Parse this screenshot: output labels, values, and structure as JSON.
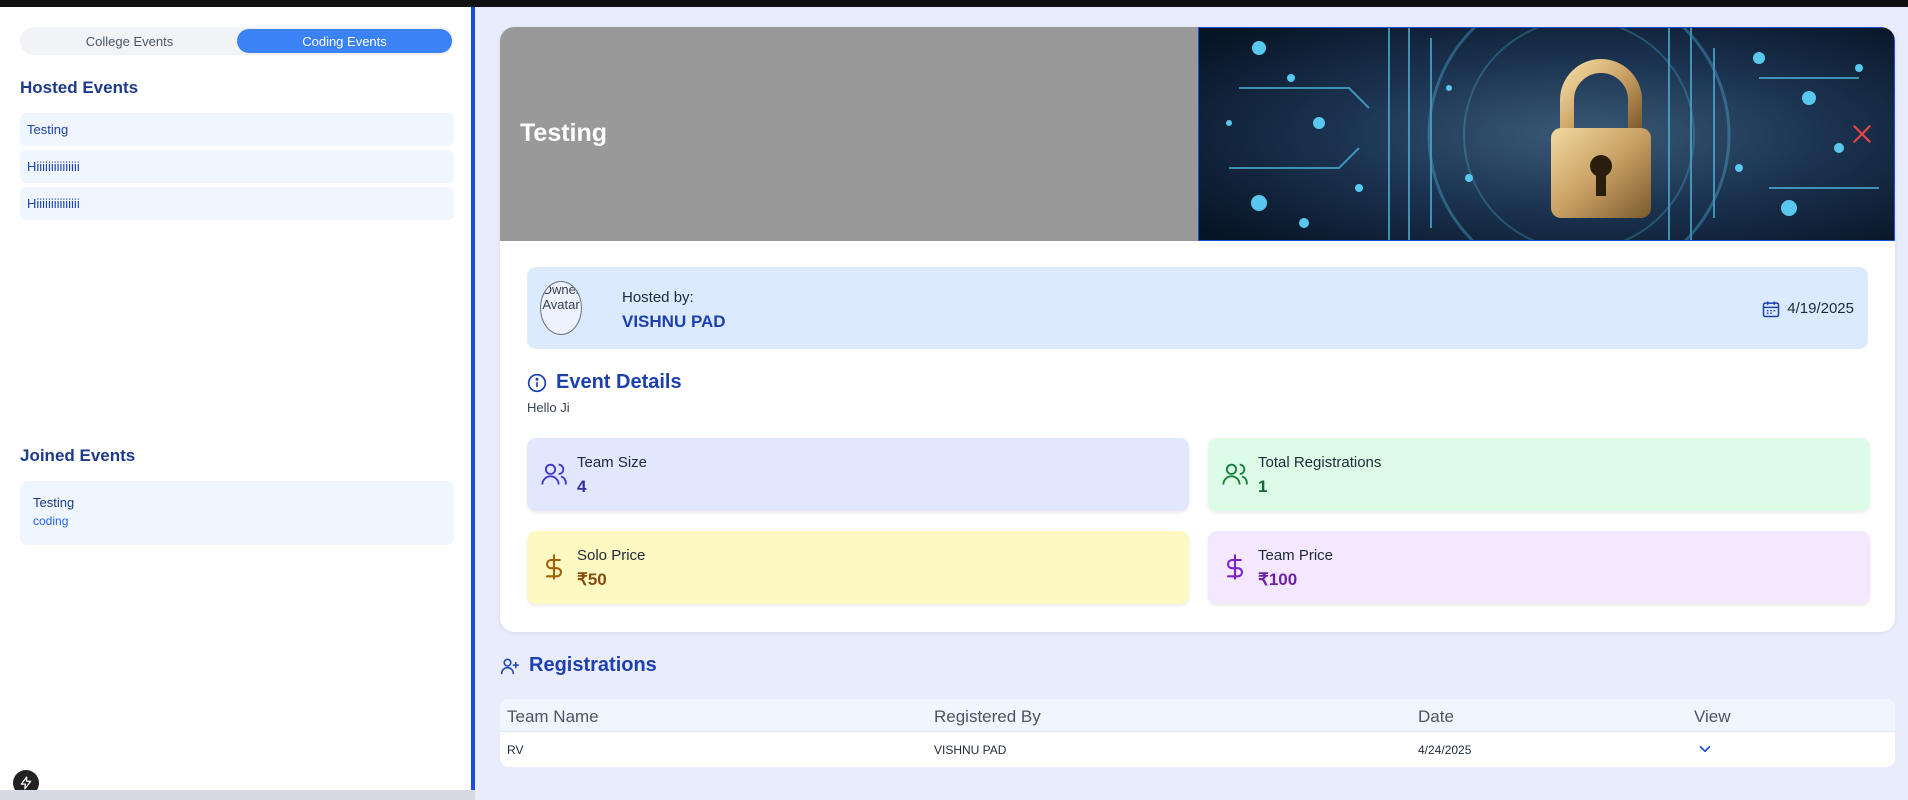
{
  "sidebar": {
    "toggle": [
      {
        "label": "College Events",
        "active": false
      },
      {
        "label": "Coding Events",
        "active": true
      }
    ],
    "hosted_title": "Hosted Events",
    "hosted_items": [
      "Testing",
      "Hiiiiiiiiiiiiiii",
      "Hiiiiiiiiiiiiiii"
    ],
    "joined_title": "Joined Events",
    "joined_items": [
      {
        "title": "Testing",
        "category": "coding"
      }
    ]
  },
  "event": {
    "title": "Testing",
    "hosted_by_label": "Hosted by:",
    "host_name": "VISHNU PAD",
    "avatar_alt": "Owner Avatar",
    "date": "4/19/2025",
    "details_title": "Event Details",
    "description": "Hello Ji",
    "stats": [
      {
        "label": "Team Size",
        "value": "4",
        "icon": "users-icon",
        "bg": "#e0e7ff",
        "color": "#4338ca"
      },
      {
        "label": "Total Registrations",
        "value": "1",
        "icon": "users-icon",
        "bg": "#dcfce7",
        "color": "#15803d"
      },
      {
        "label": "Solo Price",
        "value": "₹50",
        "icon": "dollar-icon",
        "bg": "#fef9c3",
        "color": "#a16207"
      },
      {
        "label": "Team Price",
        "value": "₹100",
        "icon": "dollar-icon",
        "bg": "#f3e8ff",
        "color": "#7e22ce"
      }
    ]
  },
  "registrations": {
    "title": "Registrations",
    "columns": [
      "Team Name",
      "Registered By",
      "Date",
      "View"
    ],
    "rows": [
      {
        "team": "RV",
        "registered_by": "VISHNU PAD",
        "date": "4/24/2025"
      }
    ]
  },
  "colors": {
    "accent": "#3b82f6",
    "sidebar_border": "#1d4ed8",
    "close": "#ef4444"
  }
}
